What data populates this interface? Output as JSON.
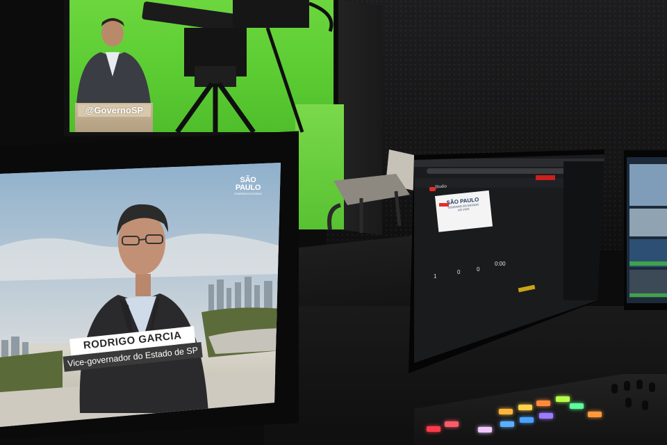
{
  "scene": {
    "description_tags": [
      "studio",
      "green-screen",
      "broadcast-monitors"
    ]
  },
  "green_screen": {
    "podium_text": "@GovernoSP"
  },
  "program_monitor": {
    "logo_line1": "SÃO PAULO",
    "logo_line2": "GOVERNO DO ESTADO",
    "lower_third": {
      "name": "RODRIGO GARCIA",
      "role": "Vice-governador do Estado de SP"
    }
  },
  "pc_monitor": {
    "app_label": "Studio",
    "thumbnail": {
      "line1": "SÃO PAULO",
      "line2": "GOVERNO DO ESTADO",
      "line3": "AO VIVO"
    },
    "stats": [
      "1",
      "0",
      "0",
      "0:00"
    ]
  },
  "colors": {
    "green_screen": "#5ccc33",
    "live_red": "#e52d27",
    "lower_third_dark": "#3a3a3a"
  },
  "control_keys": [
    {
      "color": "#ff3b4a"
    },
    {
      "color": "#ff5a6a"
    },
    {
      "color": "#f0c8ff"
    },
    {
      "color": "#5ab0ff"
    },
    {
      "color": "#4aa2ff"
    },
    {
      "color": "#9b7bff"
    },
    {
      "color": "#ffb43a"
    },
    {
      "color": "#ffd24a"
    },
    {
      "color": "#ff8a3a"
    },
    {
      "color": "#b6ff4a"
    },
    {
      "color": "#5cff9a"
    },
    {
      "color": "#ff9a3a"
    }
  ]
}
